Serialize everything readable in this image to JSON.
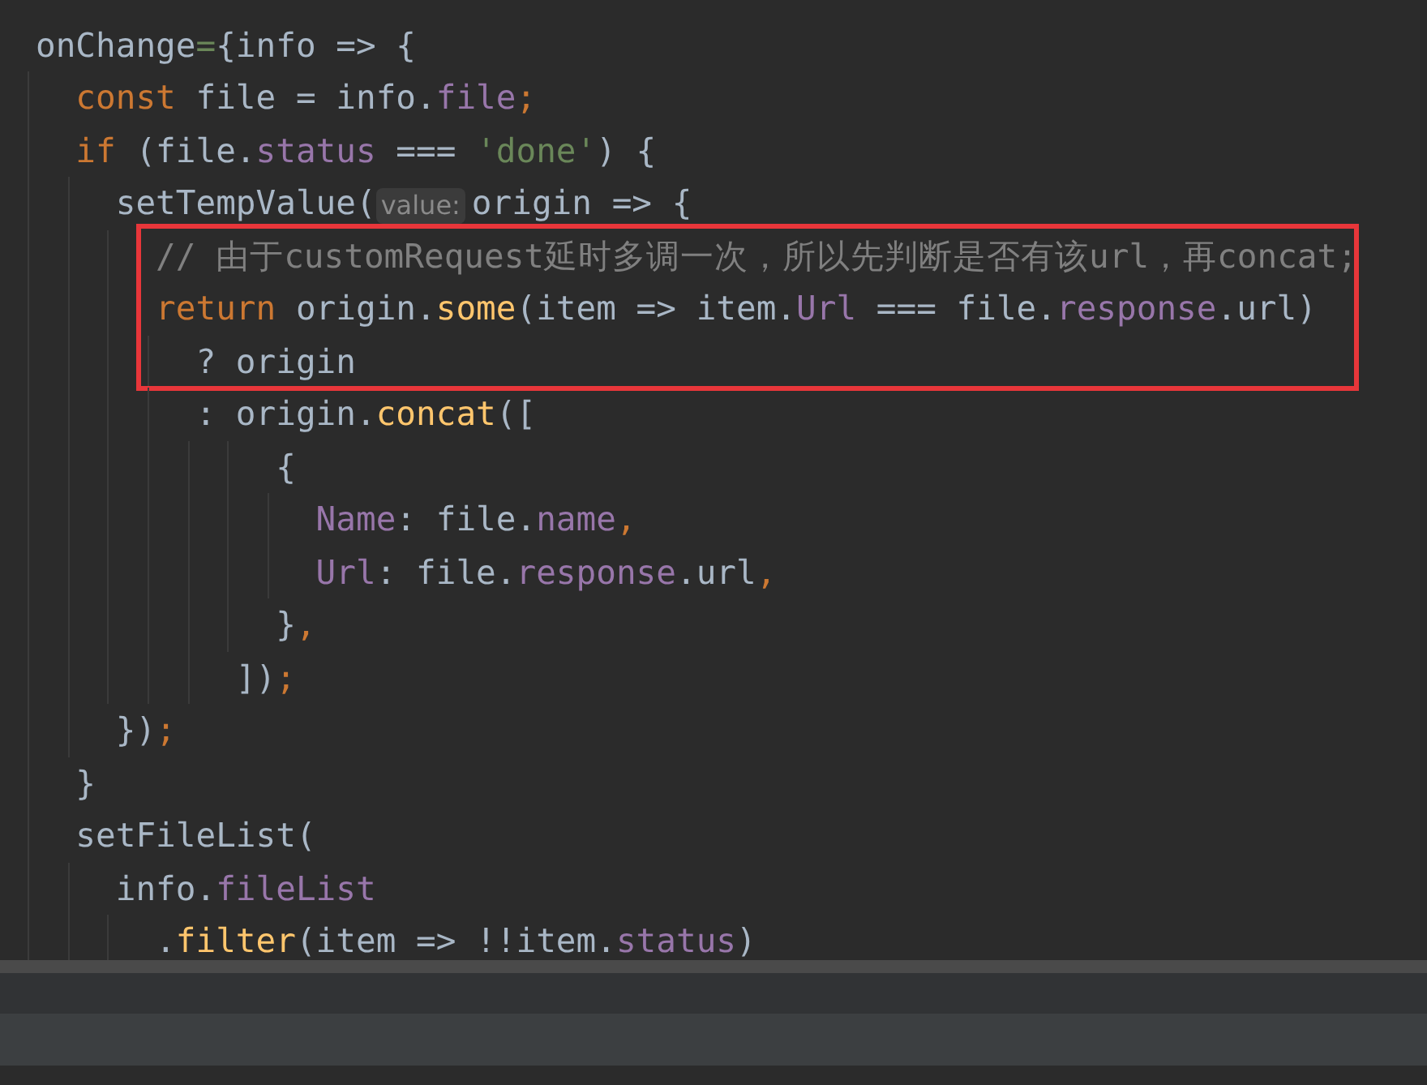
{
  "editor": {
    "lines": [
      {
        "kind": "code",
        "tokens": [
          {
            "kind": "plain",
            "text": "onChange"
          },
          {
            "kind": "attr",
            "text": "="
          },
          {
            "kind": "plain",
            "text": "{info => {"
          }
        ]
      },
      {
        "kind": "code",
        "tokens": [
          {
            "kind": "keyword",
            "text": "  const "
          },
          {
            "kind": "plain",
            "text": "file = info."
          },
          {
            "kind": "field",
            "text": "file"
          },
          {
            "kind": "punct",
            "text": ";"
          }
        ]
      },
      {
        "kind": "code",
        "tokens": [
          {
            "kind": "keyword",
            "text": "  if "
          },
          {
            "kind": "plain",
            "text": "(file."
          },
          {
            "kind": "field",
            "text": "status"
          },
          {
            "kind": "plain",
            "text": " === "
          },
          {
            "kind": "string",
            "text": "'done'"
          },
          {
            "kind": "plain",
            "text": ") {"
          }
        ]
      },
      {
        "kind": "code",
        "tokens": [
          {
            "kind": "plain",
            "text": "    setTempValue("
          },
          {
            "kind": "hint",
            "text": "value:"
          },
          {
            "kind": "plain",
            "text": "origin => {"
          }
        ]
      },
      {
        "kind": "highlight",
        "lines": [
          {
            "kind": "code",
            "tokens": [
              {
                "kind": "comment",
                "text": "      // 由于customRequest延时多调一次，所以先判断是否有该url，再concat;"
              }
            ]
          },
          {
            "kind": "code",
            "tokens": [
              {
                "kind": "keyword",
                "text": "      return "
              },
              {
                "kind": "plain",
                "text": "origin."
              },
              {
                "kind": "method",
                "text": "some"
              },
              {
                "kind": "plain",
                "text": "(item => item."
              },
              {
                "kind": "field",
                "text": "Url"
              },
              {
                "kind": "plain",
                "text": " === file."
              },
              {
                "kind": "field",
                "text": "response"
              },
              {
                "kind": "plain",
                "text": ".url)"
              }
            ]
          },
          {
            "kind": "code",
            "tokens": [
              {
                "kind": "plain",
                "text": "        ? origin"
              }
            ]
          }
        ]
      },
      {
        "kind": "code",
        "tokens": [
          {
            "kind": "plain",
            "text": "        : origin."
          },
          {
            "kind": "method",
            "text": "concat"
          },
          {
            "kind": "plain",
            "text": "(["
          }
        ]
      },
      {
        "kind": "code",
        "tokens": [
          {
            "kind": "plain",
            "text": "            {"
          }
        ]
      },
      {
        "kind": "code",
        "tokens": [
          {
            "kind": "field",
            "text": "              Name"
          },
          {
            "kind": "plain",
            "text": ": file."
          },
          {
            "kind": "field",
            "text": "name"
          },
          {
            "kind": "punct",
            "text": ","
          }
        ]
      },
      {
        "kind": "code",
        "tokens": [
          {
            "kind": "field",
            "text": "              Url"
          },
          {
            "kind": "plain",
            "text": ": file."
          },
          {
            "kind": "field",
            "text": "response"
          },
          {
            "kind": "plain",
            "text": ".url"
          },
          {
            "kind": "punct",
            "text": ","
          }
        ]
      },
      {
        "kind": "code",
        "tokens": [
          {
            "kind": "plain",
            "text": "            }"
          },
          {
            "kind": "punct",
            "text": ","
          }
        ]
      },
      {
        "kind": "code",
        "tokens": [
          {
            "kind": "plain",
            "text": "          ])"
          },
          {
            "kind": "punct",
            "text": ";"
          }
        ]
      },
      {
        "kind": "code",
        "tokens": [
          {
            "kind": "plain",
            "text": "    })"
          },
          {
            "kind": "punct",
            "text": ";"
          }
        ]
      },
      {
        "kind": "code",
        "tokens": [
          {
            "kind": "plain",
            "text": "  }"
          }
        ]
      },
      {
        "kind": "code",
        "tokens": [
          {
            "kind": "plain",
            "text": "  setFileList("
          }
        ]
      },
      {
        "kind": "code",
        "tokens": [
          {
            "kind": "plain",
            "text": "    info."
          },
          {
            "kind": "field",
            "text": "fileList"
          }
        ]
      },
      {
        "kind": "code",
        "tokens": [
          {
            "kind": "plain",
            "text": "      ."
          },
          {
            "kind": "method",
            "text": "filter"
          },
          {
            "kind": "plain",
            "text": "(item => !!item."
          },
          {
            "kind": "field",
            "text": "status"
          },
          {
            "kind": "plain",
            "text": ")"
          }
        ]
      }
    ]
  }
}
